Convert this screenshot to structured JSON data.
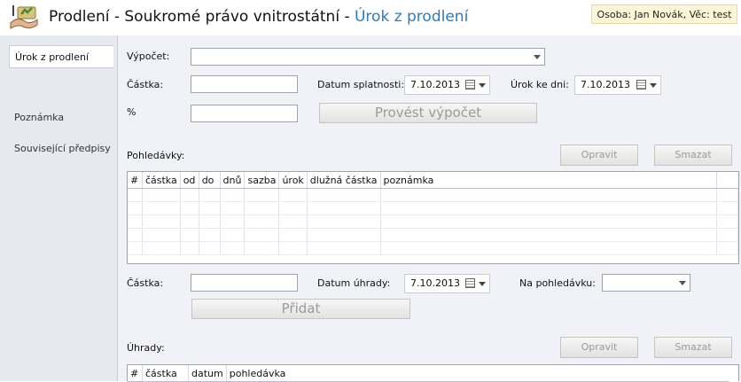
{
  "header": {
    "title_main": "Prodlení - Soukromé právo vnitrostátní - ",
    "title_sub": "Úrok z prodlení",
    "person_info": "Osoba: Jan Novák, Věc: test"
  },
  "sidebar": {
    "items": [
      {
        "label": "Úrok z prodlení"
      },
      {
        "label": "Poznámka"
      },
      {
        "label": "Související předpisy"
      }
    ]
  },
  "form": {
    "vypocet_label": "Výpočet:",
    "castka_label": "Částka:",
    "percent_label": "%",
    "datum_splatnosti_label": "Datum splatnosti:",
    "datum_splatnosti_value": "7.10.2013",
    "urok_ke_dni_label": "Úrok ke dni:",
    "urok_ke_dni_value": "7.10.2013",
    "provest_button": "Provést výpočet"
  },
  "pohledavky": {
    "label": "Pohledávky:",
    "edit_button": "Opravit",
    "delete_button": "Smazat",
    "columns": [
      "#",
      "částka",
      "od",
      "do",
      "dnů",
      "sazba",
      "úrok",
      "dlužná částka",
      "poznámka"
    ]
  },
  "payment_form": {
    "castka_label": "Částka:",
    "datum_uhrady_label": "Datum úhrady:",
    "datum_uhrady_value": "7.10.2013",
    "na_pohledavku_label": "Na pohledávku:",
    "pridat_button": "Přidat"
  },
  "uhrady": {
    "label": "Úhrady:",
    "edit_button": "Opravit",
    "delete_button": "Smazat",
    "columns": [
      "#",
      "částka",
      "datum",
      "pohledávka"
    ]
  }
}
